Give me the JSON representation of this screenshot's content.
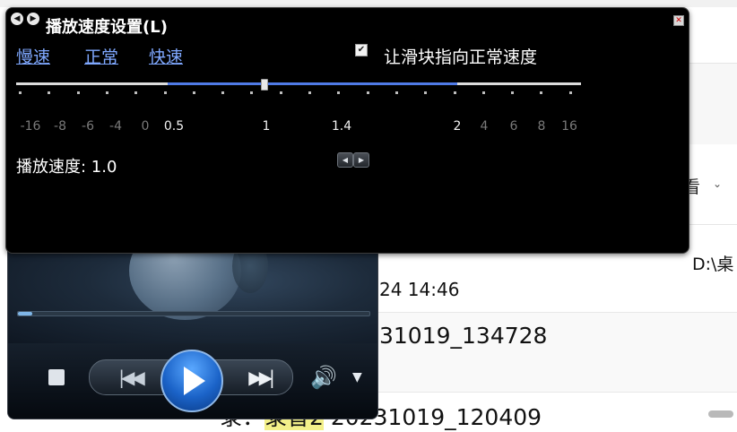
{
  "background_window": {
    "view_label": "看",
    "path_text": "D:\\桌",
    "date_text": "24 14:46",
    "file_name_1": "31019_134728",
    "bottom_prefix": "录：",
    "bottom_highlight": "录音2",
    "bottom_suffix": " 20231019_120409"
  },
  "dialog": {
    "title": "播放速度设置(L)",
    "close_glyph": "✕",
    "nav_prev_glyph": "◀",
    "nav_next_glyph": "▶",
    "links": {
      "slow": "慢速",
      "normal": "正常",
      "fast": "快速"
    },
    "checkbox_label": "让滑块指向正常速度",
    "checkbox_checked": true,
    "tick_labels": [
      "-16",
      "-8",
      "-6",
      "-4",
      "0",
      "0.5",
      "1",
      "1.4",
      "2",
      "4",
      "6",
      "8",
      "16"
    ],
    "speed_prefix": "播放速度: ",
    "speed_value": "1.0",
    "slider_value": 1.0,
    "step_down_glyph": "◀",
    "step_up_glyph": "▶",
    "range_color": "#4f7ae6"
  },
  "player": {
    "progress_fraction": 0.04,
    "prev_glyph": "|◀◀",
    "next_glyph": "▶▶|",
    "volume_glyph": "🔊",
    "menu_chevron": "▼",
    "accent": "#1b63c8"
  }
}
